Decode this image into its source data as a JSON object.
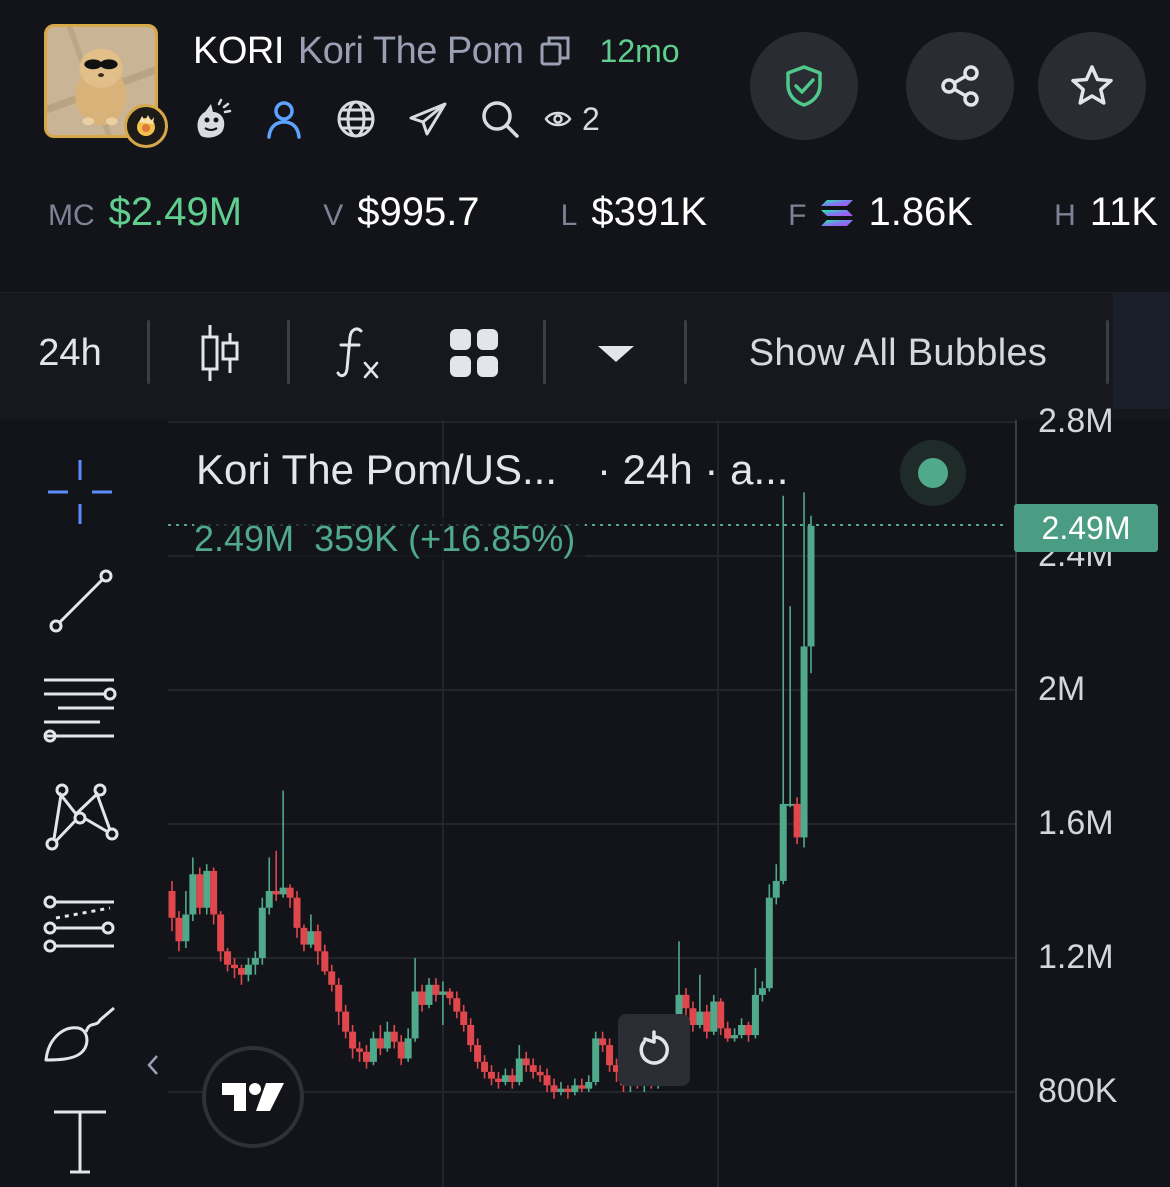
{
  "token": {
    "ticker": "KORI",
    "name": "Kori The Pom",
    "age": "12mo",
    "watchers": "2"
  },
  "stats": [
    {
      "label": "MC",
      "value": "$2.49M",
      "color": "#5fce8f"
    },
    {
      "label": "V",
      "value": "$995.7"
    },
    {
      "label": "L",
      "value": "$391K"
    },
    {
      "label": "F",
      "value": "1.86K",
      "icon": "solana-icon"
    },
    {
      "label": "H",
      "value": "11K"
    }
  ],
  "toolbar": {
    "interval": "24h",
    "bubbles_label": "Show All Bubbles"
  },
  "chart": {
    "legend_pair": "Kori The Pom/US...",
    "legend_meta": "· 24h · a...",
    "legend_close": "2.49M",
    "legend_change": "359K (+16.85%)",
    "price_tag": "2.49M",
    "y_ticks": [
      "2.8M",
      "2.4M",
      "2M",
      "1.6M",
      "1.2M",
      "800K"
    ],
    "up_color": "#4fa98a",
    "down_color": "#e0474c"
  },
  "chart_data": {
    "type": "candlestick",
    "title": "",
    "ylim": [
      700000,
      2800000
    ],
    "y_ticks": [
      800000,
      1200000,
      1600000,
      2000000,
      2400000,
      2800000
    ],
    "last_price": 2490000,
    "candles": [
      [
        1400000,
        1320000,
        1430000,
        1280000
      ],
      [
        1320000,
        1250000,
        1340000,
        1220000
      ],
      [
        1250000,
        1330000,
        1400000,
        1230000
      ],
      [
        1330000,
        1450000,
        1500000,
        1310000
      ],
      [
        1450000,
        1350000,
        1470000,
        1330000
      ],
      [
        1350000,
        1460000,
        1480000,
        1330000
      ],
      [
        1460000,
        1330000,
        1470000,
        1300000
      ],
      [
        1330000,
        1220000,
        1340000,
        1190000
      ],
      [
        1220000,
        1180000,
        1230000,
        1160000
      ],
      [
        1180000,
        1170000,
        1200000,
        1140000
      ],
      [
        1170000,
        1150000,
        1180000,
        1120000
      ],
      [
        1150000,
        1180000,
        1200000,
        1130000
      ],
      [
        1180000,
        1200000,
        1220000,
        1150000
      ],
      [
        1200000,
        1350000,
        1380000,
        1180000
      ],
      [
        1350000,
        1400000,
        1500000,
        1330000
      ],
      [
        1400000,
        1390000,
        1520000,
        1370000
      ],
      [
        1390000,
        1410000,
        1700000,
        1380000
      ],
      [
        1410000,
        1380000,
        1420000,
        1350000
      ],
      [
        1380000,
        1290000,
        1400000,
        1260000
      ],
      [
        1290000,
        1240000,
        1300000,
        1220000
      ],
      [
        1240000,
        1280000,
        1330000,
        1230000
      ],
      [
        1280000,
        1220000,
        1300000,
        1180000
      ],
      [
        1220000,
        1160000,
        1240000,
        1150000
      ],
      [
        1160000,
        1120000,
        1180000,
        1100000
      ],
      [
        1120000,
        1040000,
        1140000,
        1000000
      ],
      [
        1040000,
        980000,
        1060000,
        960000
      ],
      [
        980000,
        930000,
        1000000,
        900000
      ],
      [
        930000,
        920000,
        950000,
        890000
      ],
      [
        920000,
        890000,
        940000,
        870000
      ],
      [
        890000,
        960000,
        980000,
        880000
      ],
      [
        960000,
        930000,
        1000000,
        910000
      ],
      [
        930000,
        980000,
        1010000,
        920000
      ],
      [
        980000,
        950000,
        1000000,
        930000
      ],
      [
        950000,
        900000,
        970000,
        880000
      ],
      [
        900000,
        960000,
        990000,
        890000
      ],
      [
        960000,
        1100000,
        1200000,
        950000
      ],
      [
        1100000,
        1060000,
        1120000,
        1040000
      ],
      [
        1060000,
        1120000,
        1140000,
        1050000
      ],
      [
        1120000,
        1090000,
        1140000,
        1070000
      ],
      [
        1090000,
        1100000,
        1130000,
        1000000
      ],
      [
        1100000,
        1080000,
        1110000,
        1060000
      ],
      [
        1080000,
        1040000,
        1100000,
        1020000
      ],
      [
        1040000,
        1000000,
        1060000,
        980000
      ],
      [
        1000000,
        940000,
        1020000,
        920000
      ],
      [
        940000,
        890000,
        960000,
        870000
      ],
      [
        890000,
        860000,
        910000,
        840000
      ],
      [
        860000,
        840000,
        880000,
        820000
      ],
      [
        840000,
        830000,
        860000,
        810000
      ],
      [
        830000,
        850000,
        870000,
        820000
      ],
      [
        850000,
        830000,
        870000,
        810000
      ],
      [
        830000,
        900000,
        940000,
        820000
      ],
      [
        900000,
        880000,
        920000,
        860000
      ],
      [
        880000,
        860000,
        900000,
        840000
      ],
      [
        860000,
        850000,
        880000,
        830000
      ],
      [
        850000,
        820000,
        870000,
        800000
      ],
      [
        820000,
        800000,
        840000,
        780000
      ],
      [
        800000,
        810000,
        830000,
        790000
      ],
      [
        810000,
        800000,
        820000,
        780000
      ],
      [
        800000,
        820000,
        840000,
        790000
      ],
      [
        820000,
        810000,
        840000,
        800000
      ],
      [
        810000,
        830000,
        850000,
        800000
      ],
      [
        830000,
        960000,
        980000,
        820000
      ],
      [
        960000,
        940000,
        980000,
        920000
      ],
      [
        940000,
        880000,
        960000,
        860000
      ],
      [
        880000,
        860000,
        900000,
        830000
      ],
      [
        860000,
        820000,
        880000,
        800000
      ],
      [
        820000,
        830000,
        850000,
        800000
      ],
      [
        830000,
        820000,
        850000,
        810000
      ],
      [
        820000,
        830000,
        850000,
        800000
      ],
      [
        830000,
        820000,
        850000,
        810000
      ],
      [
        820000,
        840000,
        860000,
        810000
      ],
      [
        840000,
        830000,
        860000,
        820000
      ],
      [
        830000,
        850000,
        880000,
        820000
      ],
      [
        850000,
        1090000,
        1250000,
        840000
      ],
      [
        1090000,
        1050000,
        1110000,
        1020000
      ],
      [
        1050000,
        1000000,
        1070000,
        980000
      ],
      [
        1000000,
        1040000,
        1150000,
        990000
      ],
      [
        1040000,
        980000,
        1060000,
        960000
      ],
      [
        980000,
        1070000,
        1090000,
        970000
      ],
      [
        1070000,
        990000,
        1080000,
        970000
      ],
      [
        990000,
        960000,
        1010000,
        950000
      ],
      [
        960000,
        970000,
        990000,
        950000
      ],
      [
        970000,
        1000000,
        1020000,
        960000
      ],
      [
        1000000,
        970000,
        1010000,
        950000
      ],
      [
        970000,
        1090000,
        1170000,
        960000
      ],
      [
        1090000,
        1110000,
        1130000,
        1070000
      ],
      [
        1110000,
        1380000,
        1420000,
        1100000
      ],
      [
        1380000,
        1430000,
        1480000,
        1360000
      ],
      [
        1430000,
        1660000,
        2580000,
        1420000
      ],
      [
        1660000,
        1660000,
        2250000,
        1650000
      ],
      [
        1660000,
        1560000,
        1680000,
        1540000
      ],
      [
        1560000,
        2130000,
        2590000,
        1530000
      ],
      [
        2130000,
        2490000,
        2520000,
        2050000
      ]
    ]
  }
}
